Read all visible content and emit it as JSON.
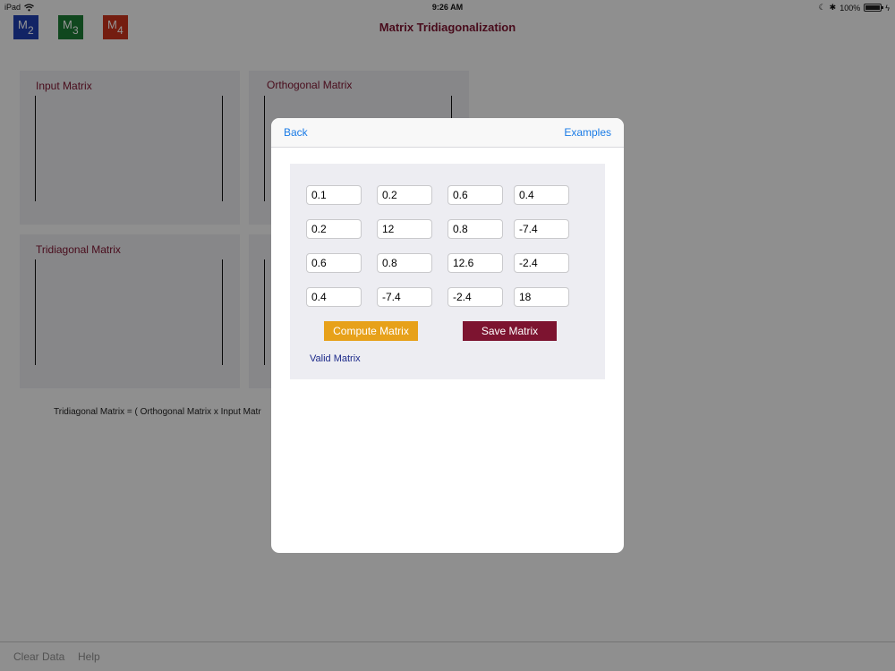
{
  "status_bar": {
    "device": "iPad",
    "time": "9:26 AM",
    "battery": "100%"
  },
  "toolbar": {
    "tiles": [
      {
        "letter": "M",
        "sub": "2",
        "color": "#1f3fae"
      },
      {
        "letter": "M",
        "sub": "3",
        "color": "#1d7a34"
      },
      {
        "letter": "M",
        "sub": "4",
        "color": "#c8321c"
      }
    ],
    "title": "Matrix Tridiagonalization"
  },
  "panels": {
    "input": "Input Matrix",
    "orthogonal": "Orthogonal Matrix",
    "tridiagonal": "Tridiagonal Matrix"
  },
  "formula": "Tridiagonal Matrix = ( Orthogonal Matrix x Input Matr",
  "bottom_bar": {
    "clear": "Clear Data",
    "help": "Help"
  },
  "modal": {
    "back": "Back",
    "examples": "Examples",
    "matrix": [
      [
        "0.1",
        "0.2",
        "0.6",
        "0.4"
      ],
      [
        "0.2",
        "12",
        "0.8",
        "-7.4"
      ],
      [
        "0.6",
        "0.8",
        "12.6",
        "-2.4"
      ],
      [
        "0.4",
        "-7.4",
        "-2.4",
        "18"
      ]
    ],
    "compute_label": "Compute Matrix",
    "save_label": "Save Matrix",
    "status": "Valid Matrix"
  },
  "colors": {
    "accent": "#7d1430",
    "link": "#1a7be6",
    "compute": "#e7a11a"
  }
}
